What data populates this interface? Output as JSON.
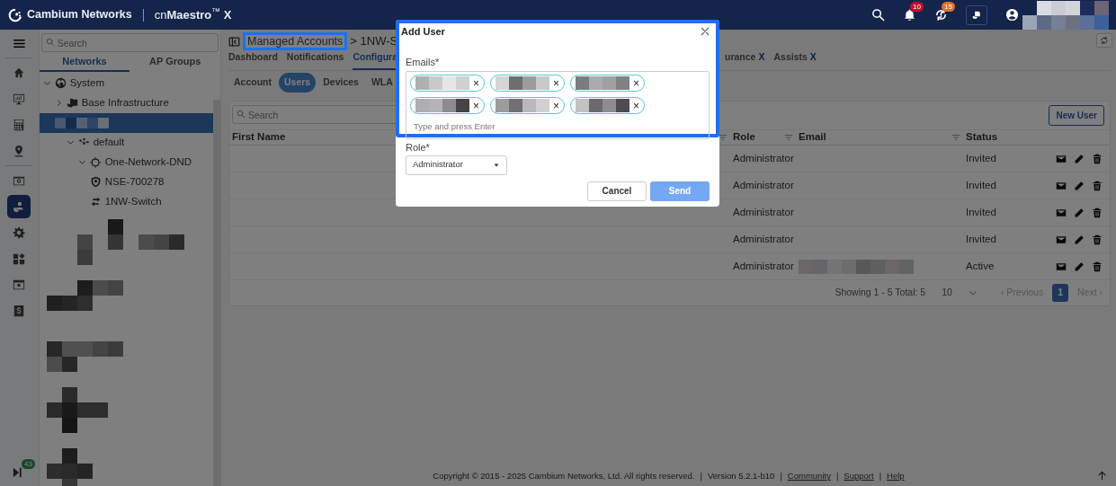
{
  "topbar": {
    "brand": "Cambium Networks",
    "product": "cn**Maestro**$^{™}$ **X**",
    "alerts_badge": "10",
    "sync_badge": "15"
  },
  "rail": {
    "items": [
      {
        "kind": "home",
        "selected": false
      },
      {
        "kind": "monitor",
        "selected": false
      },
      {
        "kind": "calculator",
        "selected": false
      },
      {
        "kind": "location",
        "selected": false
      },
      {
        "kind": "screen",
        "selected": false
      },
      {
        "kind": "users",
        "selected": true
      },
      {
        "kind": "gear",
        "selected": false
      },
      {
        "kind": "widgets",
        "selected": false
      },
      {
        "kind": "screen-gear",
        "selected": false
      },
      {
        "kind": "dollar",
        "selected": false
      }
    ],
    "bottom_badge": "43"
  },
  "tree_panel": {
    "search_placeholder": "Search",
    "tabs": [
      {
        "label": "Networks",
        "selected": true
      },
      {
        "label": "AP Groups",
        "selected": false
      }
    ],
    "tree": [
      {
        "label": "System",
        "kind": "globe",
        "expanded": true,
        "selected": false,
        "children": [
          {
            "label": "Base Infrastructure",
            "kind": "folder",
            "expanded": false,
            "selected": false
          },
          {
            "kind": "redacted",
            "selected": true,
            "children": [
              {
                "label": "default",
                "kind": "network",
                "expanded": true,
                "selected": false,
                "children": [
                  {
                    "label": "One-Network-DND",
                    "kind": "site",
                    "expanded": true,
                    "selected": false,
                    "children": [
                      {
                        "label": "NSE-700278",
                        "kind": "shield",
                        "selected": false
                      },
                      {
                        "label": "1NW-Switch",
                        "kind": "switch",
                        "selected": false
                      }
                    ]
                  }
                ]
              }
            ]
          }
        ]
      }
    ]
  },
  "main": {
    "breadcrumb": {
      "root": "Managed Accounts",
      "root_highlighted": true,
      "rest": "> 1NW-S"
    },
    "tabs": [
      {
        "label": "Dashboard",
        "selected": false
      },
      {
        "label": "Notifications",
        "selected": false
      },
      {
        "label": "Configura",
        "selected": true
      },
      {
        "label": "urance",
        "close": "X",
        "selected": false
      },
      {
        "label": "Assists",
        "close": "X",
        "selected": false
      }
    ],
    "subtabs": [
      {
        "label": "Account",
        "selected": false
      },
      {
        "label": "Users",
        "selected": true
      },
      {
        "label": "Devices",
        "selected": false
      },
      {
        "label": "WLA",
        "selected": false
      }
    ],
    "search_placeholder": "Search",
    "new_user": "New User",
    "columns": [
      {
        "label": "First Name",
        "filter": true
      },
      {
        "label": "Role",
        "filter": true
      },
      {
        "label": "Email",
        "filter": true
      },
      {
        "label": "Status",
        "filter": false
      }
    ],
    "rows": [
      {
        "role": "Administrator",
        "status": "Invited"
      },
      {
        "role": "Administrator",
        "status": "Invited"
      },
      {
        "role": "Administrator",
        "status": "Invited"
      },
      {
        "role": "Administrator",
        "status": "Invited"
      },
      {
        "role": "Administrator",
        "email": {
          "kind": "redacted"
        },
        "status": "Active"
      }
    ],
    "pagination": {
      "summary": "Showing 1 - 5 Total: 5",
      "page_size": "10",
      "previous": "‹ Previous",
      "pages": [
        {
          "label": "1",
          "selected": true
        }
      ],
      "next": "Next ›"
    },
    "footer": {
      "copyright": "Copyright © 2015 - 2025 Cambium Networks, Ltd. All rights reserved.",
      "version": "Version 5.2.1-b10",
      "separators": [
        "|",
        "|",
        "|",
        "|"
      ],
      "links": [
        "Community",
        "Support",
        "Help"
      ]
    }
  },
  "modal": {
    "title": "Add User",
    "highlighted": true,
    "emails_label": "Emails*",
    "chips": [
      {
        "remove": "×"
      },
      {
        "remove": "×"
      },
      {
        "remove": "×"
      },
      {
        "remove": "×"
      },
      {
        "remove": "×"
      },
      {
        "remove": "×"
      }
    ],
    "placeholder": "Type and press Enter",
    "role_label": "Role*",
    "role_value": "Administrator",
    "cancel": "Cancel",
    "send": "Send",
    "send_disabled": true
  }
}
